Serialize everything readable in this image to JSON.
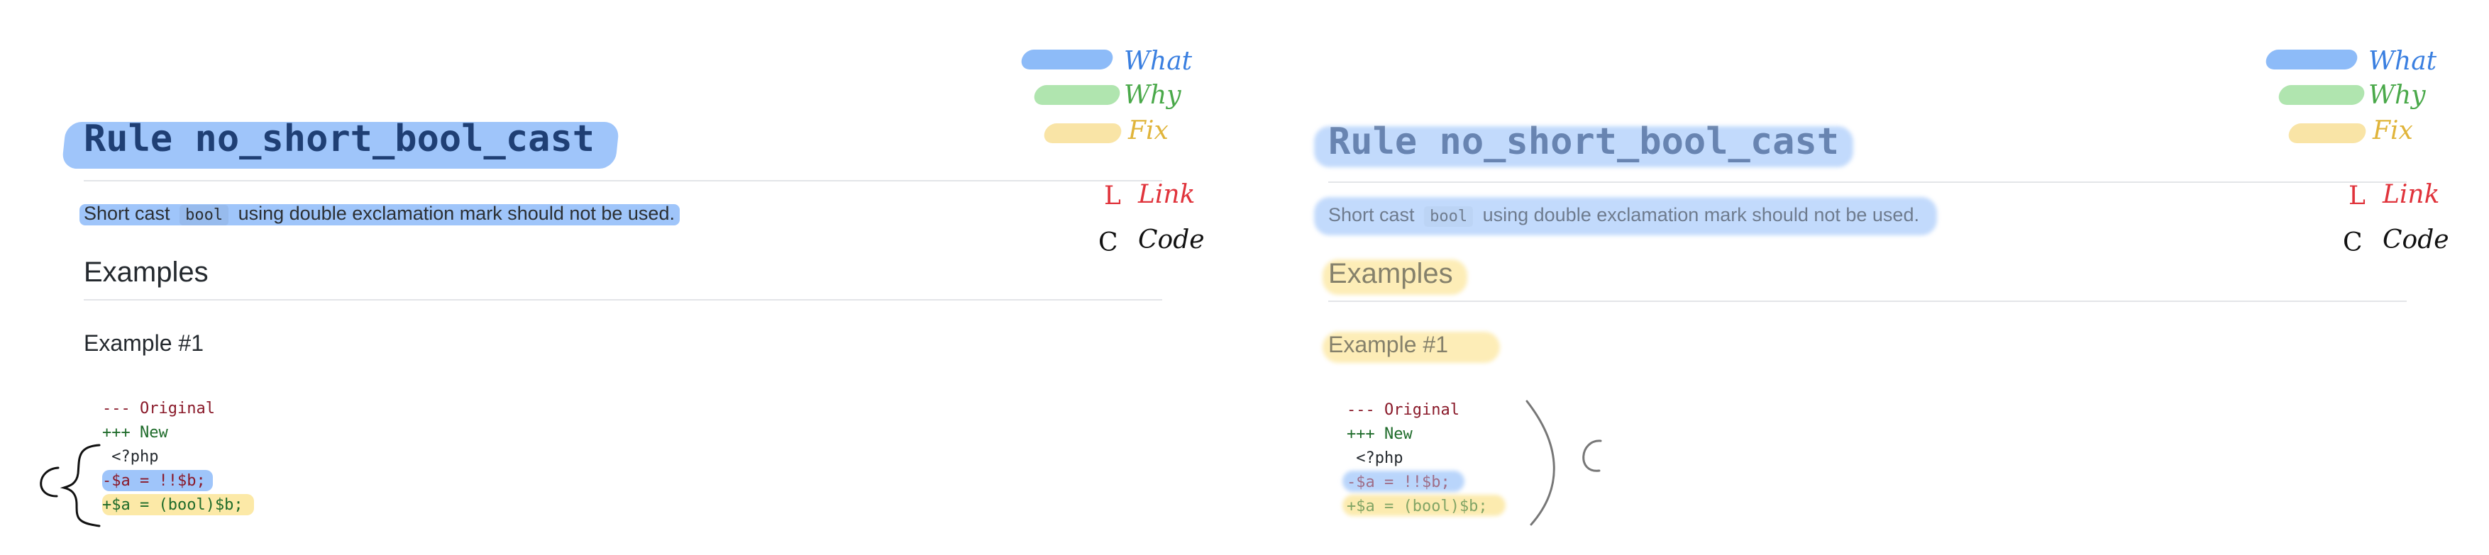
{
  "rule": {
    "title": "Rule no_short_bool_cast",
    "description_before": "Short cast",
    "description_code": "bool",
    "description_after": "using double exclamation mark should not be used."
  },
  "sections": {
    "examples_heading": "Examples",
    "example_heading": "Example #1"
  },
  "code": {
    "lines": [
      {
        "text": "--- Original",
        "kind": "del"
      },
      {
        "text": "+++ New",
        "kind": "add"
      },
      {
        "text": " <?php",
        "kind": "ctx"
      },
      {
        "text": "-$a = !!$b;",
        "kind": "del"
      },
      {
        "text": "+$a = (bool)$b;",
        "kind": "add"
      }
    ]
  },
  "legend": {
    "what": "What",
    "why": "Why",
    "fix": "Fix",
    "link_marker": "L",
    "link_word": "Link",
    "code_marker": "C",
    "code_word": "Code"
  },
  "annotation": {
    "code_marker": "C"
  },
  "colors": {
    "what": "#5096f5",
    "why": "#7bd47a",
    "fix": "#f5d26a",
    "link": "#e0333b",
    "code": "#111111"
  }
}
